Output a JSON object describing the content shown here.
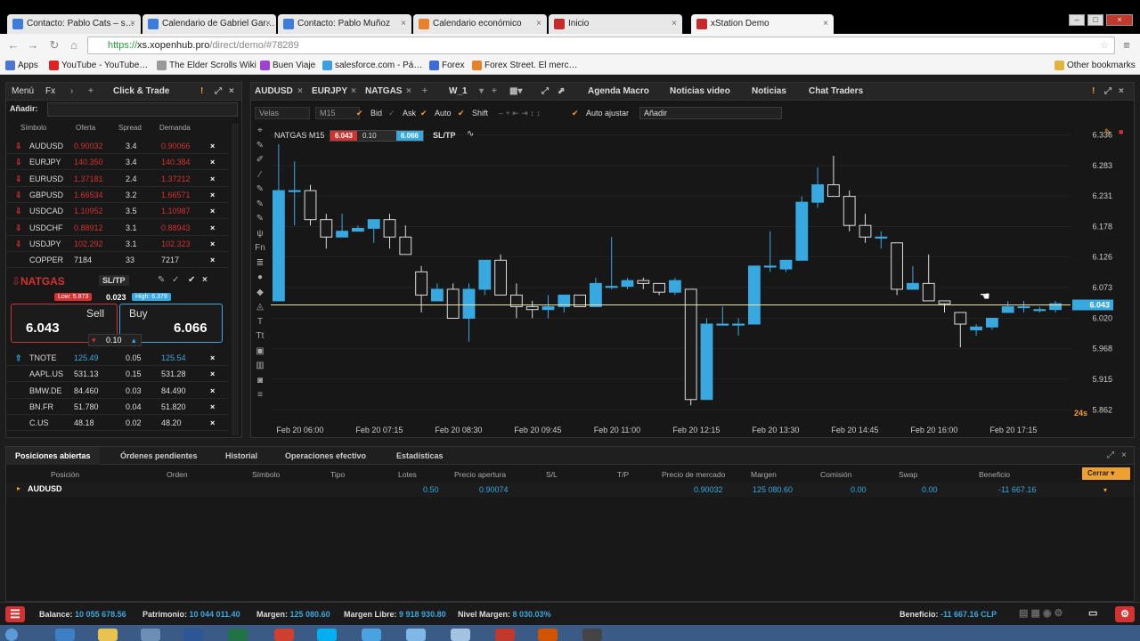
{
  "browser": {
    "tabs": [
      {
        "label": "Contacto: Pablo Cats – s…",
        "color": "#3b7dd8"
      },
      {
        "label": "Calendario de Gabriel Gar…",
        "color": "#3b7dd8"
      },
      {
        "label": "Contacto: Pablo Muñoz",
        "color": "#3b7dd8"
      },
      {
        "label": "Calendario económico",
        "color": "#e7822b"
      },
      {
        "label": "Inicio",
        "color": "#c62a2a"
      },
      {
        "label": "xStation Demo",
        "color": "#c62a2a"
      }
    ],
    "url_prefix": "https://",
    "url_host": "xs.xopenhub.pro",
    "url_path": "/direct/demo/#78289",
    "bookmarks": [
      {
        "label": "Apps",
        "color": "#4a78d0"
      },
      {
        "label": "YouTube - YouTube…",
        "color": "#d22"
      },
      {
        "label": "The Elder Scrolls Wiki",
        "color": "#999"
      },
      {
        "label": "Buen Viaje",
        "color": "#a23fd8"
      },
      {
        "label": "salesforce.com - Pá…",
        "color": "#3ba0e0"
      },
      {
        "label": "Forex",
        "color": "#3b6dd8"
      },
      {
        "label": "Forex Street. El merc…",
        "color": "#e7822b"
      }
    ],
    "other_bookmarks": "Other bookmarks"
  },
  "left_panel": {
    "menu": "Menú",
    "fx": "Fx",
    "click_trade": "Click & Trade",
    "add_label": "Añadir:",
    "headers": {
      "symbol": "Símbolo",
      "bid": "Oferta",
      "spread": "Spread",
      "ask": "Demanda"
    },
    "rows": [
      {
        "symbol": "AUDUSD",
        "bid": "0.90032",
        "spread": "3.4",
        "ask": "0.90066",
        "dir": "down"
      },
      {
        "symbol": "EURJPY",
        "bid": "140.350",
        "spread": "3.4",
        "ask": "140.384",
        "dir": "down"
      },
      {
        "symbol": "EURUSD",
        "bid": "1.37181",
        "spread": "2.4",
        "ask": "1.37212",
        "dir": "down"
      },
      {
        "symbol": "GBPUSD",
        "bid": "1.66534",
        "spread": "3.2",
        "ask": "1.66571",
        "dir": "down"
      },
      {
        "symbol": "USDCAD",
        "bid": "1.10952",
        "spread": "3.5",
        "ask": "1.10987",
        "dir": "down"
      },
      {
        "symbol": "USDCHF",
        "bid": "0.88912",
        "spread": "3.1",
        "ask": "0.88943",
        "dir": "down"
      },
      {
        "symbol": "USDJPY",
        "bid": "102.292",
        "spread": "3.1",
        "ask": "102.323",
        "dir": "down"
      },
      {
        "symbol": "COPPER",
        "bid": "7184",
        "spread": "33",
        "ask": "7217",
        "dir": "none"
      }
    ],
    "ticket": {
      "symbol": "NATGAS",
      "sltp": "SL/TP",
      "low": "Low: 5.873",
      "spread": "0.023",
      "high": "High: 6.379",
      "sell_label": "Sell",
      "buy_label": "Buy",
      "sell_price": "6.043",
      "buy_price": "6.066",
      "volume": "0.10"
    },
    "rows2": [
      {
        "symbol": "TNOTE",
        "bid": "125.49",
        "spread": "0.05",
        "ask": "125.54",
        "dir": "up"
      },
      {
        "symbol": "AAPL.US",
        "bid": "531.13",
        "spread": "0.15",
        "ask": "531.28",
        "dir": "none"
      },
      {
        "symbol": "BMW.DE",
        "bid": "84.460",
        "spread": "0.03",
        "ask": "84.490",
        "dir": "none"
      },
      {
        "symbol": "BN.FR",
        "bid": "51.780",
        "spread": "0.04",
        "ask": "51.820",
        "dir": "none"
      },
      {
        "symbol": "C.US",
        "bid": "48.18",
        "spread": "0.02",
        "ask": "48.20",
        "dir": "none"
      }
    ]
  },
  "chart_header": {
    "tabs": [
      "AUDUSD",
      "EURJPY",
      "NATGAS"
    ],
    "workspace": "W_1",
    "menu": [
      "Agenda Macro",
      "Noticias video",
      "Noticias",
      "Chat Traders"
    ],
    "toolbar": {
      "type": "Velas",
      "tf": "M15",
      "bid": "Bid",
      "ask": "Ask",
      "auto": "Auto",
      "shift": "Shift",
      "autofit": "Auto ajustar",
      "add": "Añadir"
    },
    "chart_title": "NATGAS M15",
    "ct_sell": "6.043",
    "ct_vol": "0.10",
    "ct_buy": "6.066",
    "ct_sltp": "SL/TP",
    "countdown": "24s"
  },
  "chart_data": {
    "type": "candlestick",
    "symbol": "NATGAS",
    "timeframe": "M15",
    "x_ticks": [
      "Feb 20 06:00",
      "Feb 20 07:15",
      "Feb 20 08:30",
      "Feb 20 09:45",
      "Feb 20 11:00",
      "Feb 20 12:15",
      "Feb 20 13:30",
      "Feb 20 14:45",
      "Feb 20 16:00",
      "Feb 20 17:15"
    ],
    "y_ticks": [
      6.336,
      6.283,
      6.231,
      6.178,
      6.126,
      6.073,
      6.02,
      5.968,
      5.915,
      5.862
    ],
    "ylim": [
      5.85,
      6.35
    ],
    "current_price": 6.043,
    "candles": [
      {
        "o": 6.05,
        "h": 6.32,
        "l": 6.05,
        "c": 6.24
      },
      {
        "o": 6.24,
        "h": 6.29,
        "l": 6.18,
        "c": 6.24
      },
      {
        "o": 6.24,
        "h": 6.25,
        "l": 6.18,
        "c": 6.19
      },
      {
        "o": 6.19,
        "h": 6.2,
        "l": 6.14,
        "c": 6.16
      },
      {
        "o": 6.16,
        "h": 6.2,
        "l": 6.16,
        "c": 6.17
      },
      {
        "o": 6.17,
        "h": 6.18,
        "l": 6.17,
        "c": 6.175
      },
      {
        "o": 6.175,
        "h": 6.19,
        "l": 6.15,
        "c": 6.19
      },
      {
        "o": 6.19,
        "h": 6.2,
        "l": 6.14,
        "c": 6.16
      },
      {
        "o": 6.16,
        "h": 6.18,
        "l": 6.13,
        "c": 6.13
      },
      {
        "o": 6.1,
        "h": 6.11,
        "l": 6.03,
        "c": 6.06
      },
      {
        "o": 6.05,
        "h": 6.08,
        "l": 6.05,
        "c": 6.07
      },
      {
        "o": 6.07,
        "h": 6.08,
        "l": 6.02,
        "c": 6.02
      },
      {
        "o": 6.02,
        "h": 6.08,
        "l": 5.98,
        "c": 6.07
      },
      {
        "o": 6.07,
        "h": 6.12,
        "l": 6.06,
        "c": 6.12
      },
      {
        "o": 6.12,
        "h": 6.13,
        "l": 6.06,
        "c": 6.06
      },
      {
        "o": 6.06,
        "h": 6.08,
        "l": 6.02,
        "c": 6.04
      },
      {
        "o": 6.04,
        "h": 6.05,
        "l": 6.02,
        "c": 6.035
      },
      {
        "o": 6.035,
        "h": 6.06,
        "l": 6.02,
        "c": 6.04
      },
      {
        "o": 6.04,
        "h": 6.06,
        "l": 6.03,
        "c": 6.06
      },
      {
        "o": 6.06,
        "h": 6.06,
        "l": 6.04,
        "c": 6.04
      },
      {
        "o": 6.04,
        "h": 6.09,
        "l": 6.04,
        "c": 6.08
      },
      {
        "o": 6.075,
        "h": 6.16,
        "l": 6.07,
        "c": 6.075
      },
      {
        "o": 6.075,
        "h": 6.09,
        "l": 6.07,
        "c": 6.085
      },
      {
        "o": 6.085,
        "h": 6.09,
        "l": 6.07,
        "c": 6.08
      },
      {
        "o": 6.08,
        "h": 6.08,
        "l": 6.06,
        "c": 6.065
      },
      {
        "o": 6.065,
        "h": 6.09,
        "l": 6.06,
        "c": 6.085
      },
      {
        "o": 6.07,
        "h": 6.07,
        "l": 5.87,
        "c": 5.88
      },
      {
        "o": 5.88,
        "h": 6.02,
        "l": 5.88,
        "c": 6.01
      },
      {
        "o": 6.01,
        "h": 6.04,
        "l": 6.01,
        "c": 6.01
      },
      {
        "o": 6.01,
        "h": 6.02,
        "l": 5.99,
        "c": 6.01
      },
      {
        "o": 6.01,
        "h": 6.11,
        "l": 6.01,
        "c": 6.11
      },
      {
        "o": 6.11,
        "h": 6.17,
        "l": 6.1,
        "c": 6.11
      },
      {
        "o": 6.105,
        "h": 6.12,
        "l": 6.1,
        "c": 6.12
      },
      {
        "o": 6.12,
        "h": 6.23,
        "l": 6.12,
        "c": 6.22
      },
      {
        "o": 6.22,
        "h": 6.28,
        "l": 6.21,
        "c": 6.25
      },
      {
        "o": 6.25,
        "h": 6.3,
        "l": 6.23,
        "c": 6.23
      },
      {
        "o": 6.23,
        "h": 6.24,
        "l": 6.17,
        "c": 6.18
      },
      {
        "o": 6.18,
        "h": 6.2,
        "l": 6.15,
        "c": 6.16
      },
      {
        "o": 6.16,
        "h": 6.17,
        "l": 6.14,
        "c": 6.16
      },
      {
        "o": 6.15,
        "h": 6.15,
        "l": 6.06,
        "c": 6.07
      },
      {
        "o": 6.07,
        "h": 6.11,
        "l": 6.07,
        "c": 6.08
      },
      {
        "o": 6.08,
        "h": 6.13,
        "l": 6.05,
        "c": 6.05
      },
      {
        "o": 6.05,
        "h": 6.05,
        "l": 6.03,
        "c": 6.045
      },
      {
        "o": 6.03,
        "h": 6.03,
        "l": 5.97,
        "c": 6.01
      },
      {
        "o": 6.0,
        "h": 6.01,
        "l": 5.99,
        "c": 6.005
      },
      {
        "o": 6.005,
        "h": 6.02,
        "l": 6.0,
        "c": 6.02
      },
      {
        "o": 6.03,
        "h": 6.05,
        "l": 6.03,
        "c": 6.04
      },
      {
        "o": 6.04,
        "h": 6.05,
        "l": 6.03,
        "c": 6.04
      },
      {
        "o": 6.035,
        "h": 6.04,
        "l": 6.03,
        "c": 6.035
      },
      {
        "o": 6.035,
        "h": 6.05,
        "l": 6.03,
        "c": 6.045
      }
    ]
  },
  "bottom": {
    "tabs": [
      "Posiciones abiertas",
      "Órdenes pendientes",
      "Historial",
      "Operaciones efectivo",
      "Estadísticas"
    ],
    "columns": [
      "Posición",
      "Orden",
      "Símbolo",
      "Tipo",
      "Lotes",
      "Precio apertura",
      "S/L",
      "T/P",
      "Precio de mercado",
      "Margen",
      "Comisión",
      "Swap",
      "Beneficio"
    ],
    "close_label": "Cerrar",
    "position": {
      "symbol": "AUDUSD",
      "lots": "0.50",
      "open": "0.90074",
      "market": "0.90032",
      "margin": "125 080.60",
      "commission": "0.00",
      "swap": "0.00",
      "profit": "-11 667.16"
    }
  },
  "status": {
    "balance_label": "Balance:",
    "balance": "10 055 678.56",
    "equity_label": "Patrimonio:",
    "equity": "10 044 011.40",
    "margin_label": "Margen:",
    "margin": "125 080.60",
    "free_label": "Margen Libre:",
    "free": "9 918 930.80",
    "level_label": "Nivel Margen:",
    "level": "8 030.03%",
    "profit_label": "Beneficio:",
    "profit": "-11 667.16 CLP"
  },
  "colors": {
    "bull": "#38a9e0",
    "bear": "#1a1a1a",
    "sell": "#d23232",
    "accent": "#f0a030"
  }
}
